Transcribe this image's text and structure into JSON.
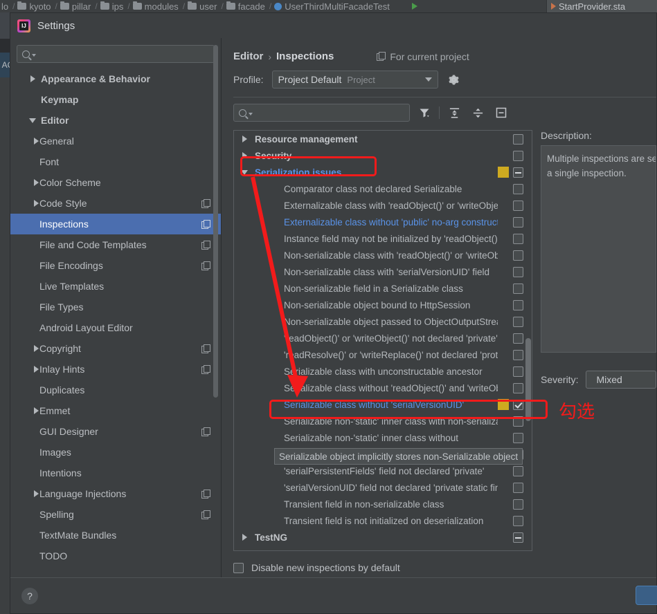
{
  "ide": {
    "breadcrumb": [
      {
        "label": "lo",
        "icon": "none"
      },
      {
        "label": "kyoto",
        "icon": "folder-icon"
      },
      {
        "label": "pillar",
        "icon": "folder-icon"
      },
      {
        "label": "ips",
        "icon": "folder-icon"
      },
      {
        "label": "modules",
        "icon": "folder-icon"
      },
      {
        "label": "user",
        "icon": "folder-icon"
      },
      {
        "label": "facade",
        "icon": "folder-icon"
      },
      {
        "label": "UserThirdMultiFacadeTest",
        "icon": "class-icon"
      }
    ],
    "editor_tab": "StartProvider.sta",
    "left_sliver_text": "AC"
  },
  "dialog": {
    "title": "Settings",
    "logo": "intellij-idea-logo"
  },
  "sidebar": {
    "search": {
      "value": "",
      "placeholder": ""
    },
    "items": [
      {
        "label": "Appearance & Behavior",
        "level": 0,
        "expander": "collapsed",
        "copy": false,
        "selected": false
      },
      {
        "label": "Keymap",
        "level": 0,
        "expander": "none",
        "copy": false,
        "selected": false
      },
      {
        "label": "Editor",
        "level": 0,
        "expander": "expanded",
        "copy": false,
        "selected": false
      },
      {
        "label": "General",
        "level": 1,
        "expander": "collapsed",
        "copy": false,
        "selected": false
      },
      {
        "label": "Font",
        "level": 1,
        "expander": "none",
        "copy": false,
        "selected": false
      },
      {
        "label": "Color Scheme",
        "level": 1,
        "expander": "collapsed",
        "copy": false,
        "selected": false
      },
      {
        "label": "Code Style",
        "level": 1,
        "expander": "collapsed",
        "copy": true,
        "selected": false
      },
      {
        "label": "Inspections",
        "level": 1,
        "expander": "none",
        "copy": true,
        "selected": true
      },
      {
        "label": "File and Code Templates",
        "level": 1,
        "expander": "none",
        "copy": true,
        "selected": false
      },
      {
        "label": "File Encodings",
        "level": 1,
        "expander": "none",
        "copy": true,
        "selected": false
      },
      {
        "label": "Live Templates",
        "level": 1,
        "expander": "none",
        "copy": false,
        "selected": false
      },
      {
        "label": "File Types",
        "level": 1,
        "expander": "none",
        "copy": false,
        "selected": false
      },
      {
        "label": "Android Layout Editor",
        "level": 1,
        "expander": "none",
        "copy": false,
        "selected": false
      },
      {
        "label": "Copyright",
        "level": 1,
        "expander": "collapsed",
        "copy": true,
        "selected": false
      },
      {
        "label": "Inlay Hints",
        "level": 1,
        "expander": "collapsed",
        "copy": true,
        "selected": false
      },
      {
        "label": "Duplicates",
        "level": 1,
        "expander": "none",
        "copy": false,
        "selected": false
      },
      {
        "label": "Emmet",
        "level": 1,
        "expander": "collapsed",
        "copy": false,
        "selected": false
      },
      {
        "label": "GUI Designer",
        "level": 1,
        "expander": "none",
        "copy": true,
        "selected": false
      },
      {
        "label": "Images",
        "level": 1,
        "expander": "none",
        "copy": false,
        "selected": false
      },
      {
        "label": "Intentions",
        "level": 1,
        "expander": "none",
        "copy": false,
        "selected": false
      },
      {
        "label": "Language Injections",
        "level": 1,
        "expander": "collapsed",
        "copy": true,
        "selected": false
      },
      {
        "label": "Spelling",
        "level": 1,
        "expander": "none",
        "copy": true,
        "selected": false
      },
      {
        "label": "TextMate Bundles",
        "level": 1,
        "expander": "none",
        "copy": false,
        "selected": false
      },
      {
        "label": "TODO",
        "level": 1,
        "expander": "none",
        "copy": false,
        "selected": false
      }
    ]
  },
  "main": {
    "breadcrumb": {
      "parent": "Editor",
      "separator": "›",
      "current": "Inspections"
    },
    "for_current_project": "For current project",
    "profile": {
      "label": "Profile:",
      "value": "Project Default",
      "scope": "Project"
    },
    "filter": {
      "search_value": "",
      "search_placeholder": "",
      "buttons": [
        {
          "name": "filter-icon"
        },
        {
          "name": "expand-all-icon"
        },
        {
          "name": "collapse-all-icon"
        },
        {
          "name": "show-only-enabled-icon"
        }
      ]
    },
    "inspections": [
      {
        "label": "Resource management",
        "type": "group",
        "expander": "collapsed",
        "check": "unchecked",
        "swatch": false,
        "highlighted": false
      },
      {
        "label": "Security",
        "type": "group",
        "expander": "collapsed",
        "check": "unchecked",
        "swatch": false,
        "highlighted": false
      },
      {
        "label": "Serialization issues",
        "type": "group",
        "expander": "expanded",
        "check": "tristate",
        "swatch": true,
        "highlighted": true
      },
      {
        "label": "Comparator class not declared Serializable",
        "type": "leaf",
        "check": "unchecked",
        "swatch": false,
        "highlighted": false
      },
      {
        "label": "Externalizable class with 'readObject()' or 'writeObject()'",
        "type": "leaf",
        "check": "unchecked",
        "swatch": false,
        "highlighted": false
      },
      {
        "label": "Externalizable class without 'public' no-arg constructor",
        "type": "leaf",
        "check": "unchecked",
        "swatch": false,
        "highlighted": true
      },
      {
        "label": "Instance field may not be initialized by 'readObject()'",
        "type": "leaf",
        "check": "unchecked",
        "swatch": false,
        "highlighted": false
      },
      {
        "label": "Non-serializable class with 'readObject()' or 'writeObject()'",
        "type": "leaf",
        "check": "unchecked",
        "swatch": false,
        "highlighted": false
      },
      {
        "label": "Non-serializable class with 'serialVersionUID' field",
        "type": "leaf",
        "check": "unchecked",
        "swatch": false,
        "highlighted": false
      },
      {
        "label": "Non-serializable field in a Serializable class",
        "type": "leaf",
        "check": "unchecked",
        "swatch": false,
        "highlighted": false
      },
      {
        "label": "Non-serializable object bound to HttpSession",
        "type": "leaf",
        "check": "unchecked",
        "swatch": false,
        "highlighted": false
      },
      {
        "label": "Non-serializable object passed to ObjectOutputStream",
        "type": "leaf",
        "check": "unchecked",
        "swatch": false,
        "highlighted": false
      },
      {
        "label": "'readObject()' or 'writeObject()' not declared 'private'",
        "type": "leaf",
        "check": "unchecked",
        "swatch": false,
        "highlighted": false
      },
      {
        "label": "'readResolve()' or 'writeReplace()' not declared 'protected'",
        "type": "leaf",
        "check": "unchecked",
        "swatch": false,
        "highlighted": false
      },
      {
        "label": "Serializable class with unconstructable ancestor",
        "type": "leaf",
        "check": "unchecked",
        "swatch": false,
        "highlighted": false
      },
      {
        "label": "Serializable class without 'readObject()' and 'writeObject()'",
        "type": "leaf",
        "check": "unchecked",
        "swatch": false,
        "highlighted": false
      },
      {
        "label": "Serializable class without 'serialVersionUID'",
        "type": "leaf",
        "check": "checked",
        "swatch": true,
        "highlighted": true
      },
      {
        "label": "Serializable non-'static' inner class with non-serializable",
        "type": "leaf",
        "check": "unchecked",
        "swatch": false,
        "highlighted": false
      },
      {
        "label": "Serializable non-'static' inner class without",
        "type": "leaf",
        "check": "unchecked",
        "swatch": false,
        "highlighted": false
      },
      {
        "label": "Serializable object implicitly stores non-Serializable object",
        "type": "leaf",
        "check": "unchecked",
        "swatch": false,
        "highlighted": false
      },
      {
        "label": "'serialPersistentFields' field not declared 'private'",
        "type": "leaf",
        "check": "unchecked",
        "swatch": false,
        "highlighted": false
      },
      {
        "label": "'serialVersionUID' field not declared 'private static final'",
        "type": "leaf",
        "check": "unchecked",
        "swatch": false,
        "highlighted": false
      },
      {
        "label": "Transient field in non-serializable class",
        "type": "leaf",
        "check": "unchecked",
        "swatch": false,
        "highlighted": false
      },
      {
        "label": "Transient field is not initialized on deserialization",
        "type": "leaf",
        "check": "unchecked",
        "swatch": false,
        "highlighted": false
      },
      {
        "label": "TestNG",
        "type": "group",
        "expander": "collapsed",
        "check": "tristate",
        "swatch": false,
        "highlighted": false
      }
    ],
    "tooltip": "Serializable object implicitly stores non-Serializable object",
    "description": {
      "label": "Description:",
      "text_line1": "Multiple inspections are selected. You can edit them as",
      "text_line2": "a single inspection."
    },
    "severity": {
      "label": "Severity:",
      "value": "Mixed"
    },
    "disable_new": {
      "label": "Disable new inspections by default",
      "checked": false
    }
  },
  "footer": {
    "help": "?",
    "ok_label": ""
  },
  "annotations": {
    "check_text": "勾选",
    "color": "#f21b1b"
  },
  "colors": {
    "dialog_bg": "#3c3f41",
    "selection_blue": "#4b6eaf",
    "link_blue": "#5a93e8",
    "swatch_yellow": "#ceaa20",
    "annotation_red": "#f21b1b"
  }
}
